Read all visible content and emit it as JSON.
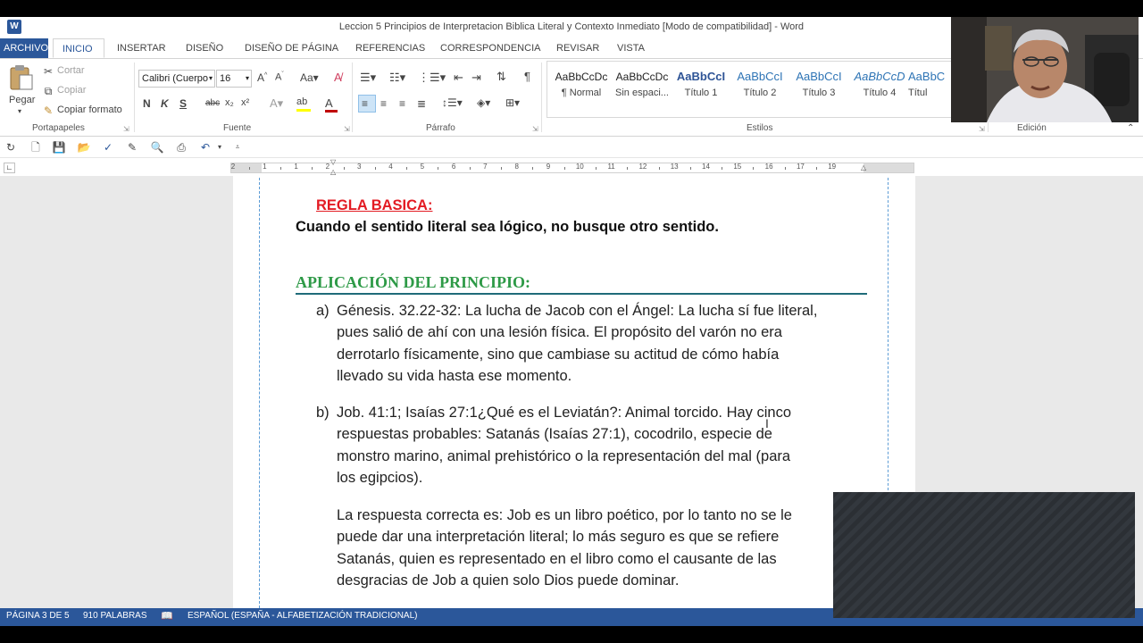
{
  "window": {
    "title": "Leccion 5  Principios de Interpretacion Biblica Literal y Contexto Inmediato [Modo de compatibilidad] - Word",
    "app_icon": "W"
  },
  "tabs": [
    "ARCHIVO",
    "INICIO",
    "INSERTAR",
    "DISEÑO",
    "DISEÑO DE PÁGINA",
    "REFERENCIAS",
    "CORRESPONDENCIA",
    "REVISAR",
    "VISTA"
  ],
  "ribbon": {
    "clipboard": {
      "paste": "Pegar",
      "cut": "Cortar",
      "copy": "Copiar",
      "format_painter": "Copiar formato",
      "group": "Portapapeles"
    },
    "font": {
      "name": "Calibri (Cuerpo",
      "size": "16",
      "group": "Fuente",
      "bold": "N",
      "italic": "K",
      "underline": "S",
      "strike": "abc",
      "subscript": "x₂",
      "superscript": "x²"
    },
    "paragraph": {
      "group": "Párrafo"
    },
    "styles": {
      "group": "Estilos",
      "items": [
        {
          "sample": "AaBbCcDc",
          "name": "¶ Normal"
        },
        {
          "sample": "AaBbCcDc",
          "name": "Sin espaci..."
        },
        {
          "sample": "AaBbCcI",
          "name": "Título 1"
        },
        {
          "sample": "AaBbCcI",
          "name": "Título 2"
        },
        {
          "sample": "AaBbCcI",
          "name": "Título 3"
        },
        {
          "sample": "AaBbCcD",
          "name": "Título 4"
        },
        {
          "sample": "AaBbC",
          "name": "Títul"
        }
      ]
    },
    "editing": {
      "group": "Edición"
    }
  },
  "ruler": {
    "numbers": [
      "2",
      "1",
      "1",
      "2",
      "3",
      "4",
      "5",
      "6",
      "7",
      "8",
      "9",
      "10",
      "11",
      "12",
      "13",
      "14",
      "15",
      "16",
      "17",
      "19"
    ]
  },
  "document": {
    "regla_basica": "REGLA BASICA:",
    "rule_text": "Cuando el sentido literal sea lógico, no busque otro sentido.",
    "heading": "APLICACIÓN DEL PRINCIPIO:",
    "item_a_letter": "a)",
    "item_a_lines": [
      "Génesis. 32.22-32: La lucha de Jacob con el Ángel: La lucha sí fue literal,",
      "pues salió de ahí con una lesión física. El propósito del varón no era",
      "derrotarlo físicamente, sino que cambiase su actitud de cómo había",
      "llevado su vida hasta ese momento."
    ],
    "item_b_letter": "b)",
    "item_b_lines": [
      "Job. 41:1; Isaías 27:1¿Qué es el Leviatán?: Animal torcido. Hay cinco",
      "respuestas probables: Satanás (Isaías 27:1), cocodrilo, especie de",
      "monstro marino, animal prehistórico o la representación del mal (para",
      "los egipcios)."
    ],
    "answer_lines": [
      "La respuesta correcta es: Job es un libro poético, por lo tanto no se le",
      "puede dar una interpretación literal; lo más seguro es que se refiere",
      "Satanás, quien es representado en el libro como el causante de las",
      "desgracias de Job a quien solo Dios puede dominar."
    ]
  },
  "status": {
    "page": "PÁGINA 3 DE 5",
    "words": "910 PALABRAS",
    "language": "ESPAÑOL (ESPAÑA - ALFABETIZACIÓN TRADICIONAL)"
  },
  "colors": {
    "accent": "#2b579a",
    "regla": "#e31b23",
    "heading": "#2e9a47"
  }
}
